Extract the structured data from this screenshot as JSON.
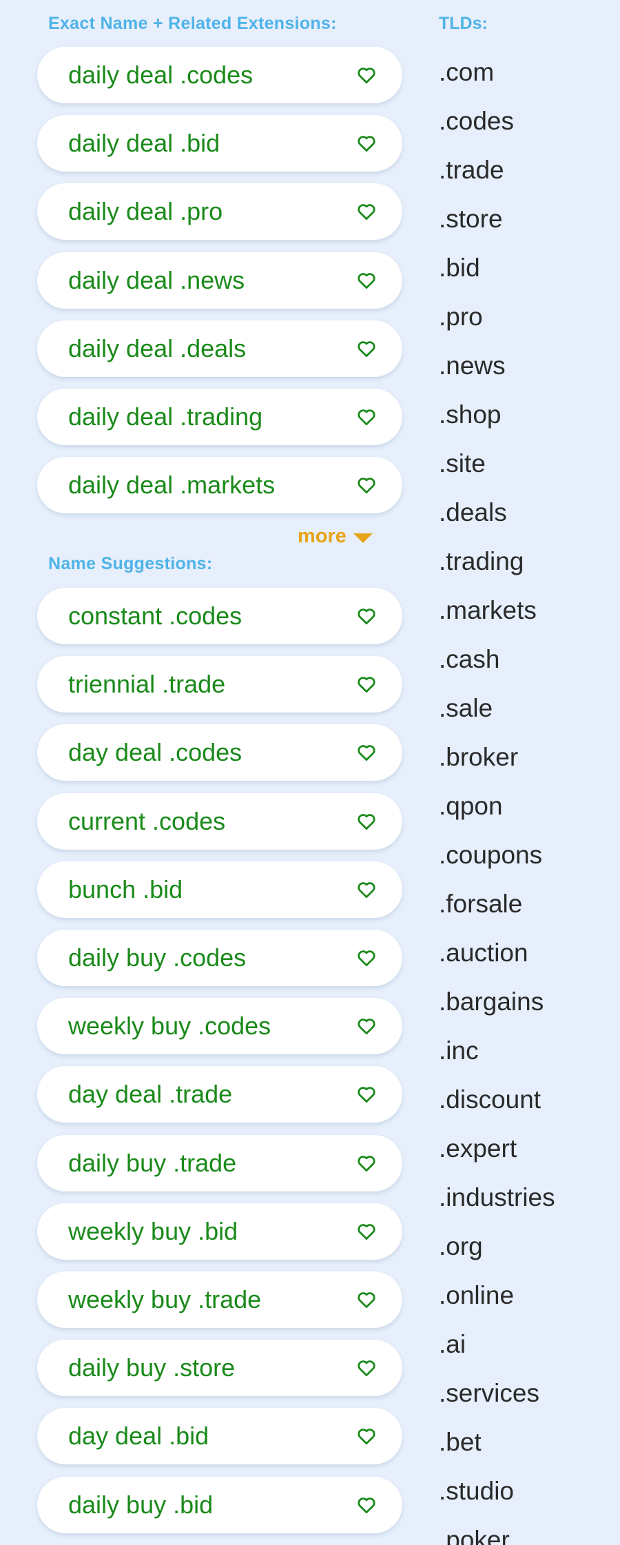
{
  "exact": {
    "heading": "Exact Name + Related Extensions:",
    "items": [
      {
        "name": "daily deal .codes"
      },
      {
        "name": "daily deal .bid"
      },
      {
        "name": "daily deal .pro"
      },
      {
        "name": "daily deal .news"
      },
      {
        "name": "daily deal .deals"
      },
      {
        "name": "daily deal .trading"
      },
      {
        "name": "daily deal .markets"
      }
    ],
    "more_label": "more"
  },
  "suggestions": {
    "heading": "Name Suggestions:",
    "items": [
      {
        "name": "constant .codes"
      },
      {
        "name": "triennial .trade"
      },
      {
        "name": "day deal .codes"
      },
      {
        "name": "current .codes"
      },
      {
        "name": "bunch .bid"
      },
      {
        "name": "daily buy .codes"
      },
      {
        "name": "weekly buy .codes"
      },
      {
        "name": "day deal .trade"
      },
      {
        "name": "daily buy .trade"
      },
      {
        "name": "weekly buy .bid"
      },
      {
        "name": "weekly buy .trade"
      },
      {
        "name": "daily buy .store"
      },
      {
        "name": "day deal .bid"
      },
      {
        "name": "daily buy .bid"
      }
    ]
  },
  "tlds": {
    "heading": "TLDs:",
    "items": [
      ".com",
      ".codes",
      ".trade",
      ".store",
      ".bid",
      ".pro",
      ".news",
      ".shop",
      ".site",
      ".deals",
      ".trading",
      ".markets",
      ".cash",
      ".sale",
      ".broker",
      ".qpon",
      ".coupons",
      ".forsale",
      ".auction",
      ".bargains",
      ".inc",
      ".discount",
      ".expert",
      ".industries",
      ".org",
      ".online",
      ".ai",
      ".services",
      ".bet",
      ".studio",
      ".poker"
    ]
  },
  "colors": {
    "background": "#e6effb",
    "heading": "#4fb3e8",
    "domain_text": "#1a8a1a",
    "heart": "#1a8a1a",
    "more": "#e8a418",
    "tld_text": "#2a2a2a"
  },
  "icons": {
    "favorite": "heart-outline-icon",
    "more": "caret-down-icon"
  }
}
